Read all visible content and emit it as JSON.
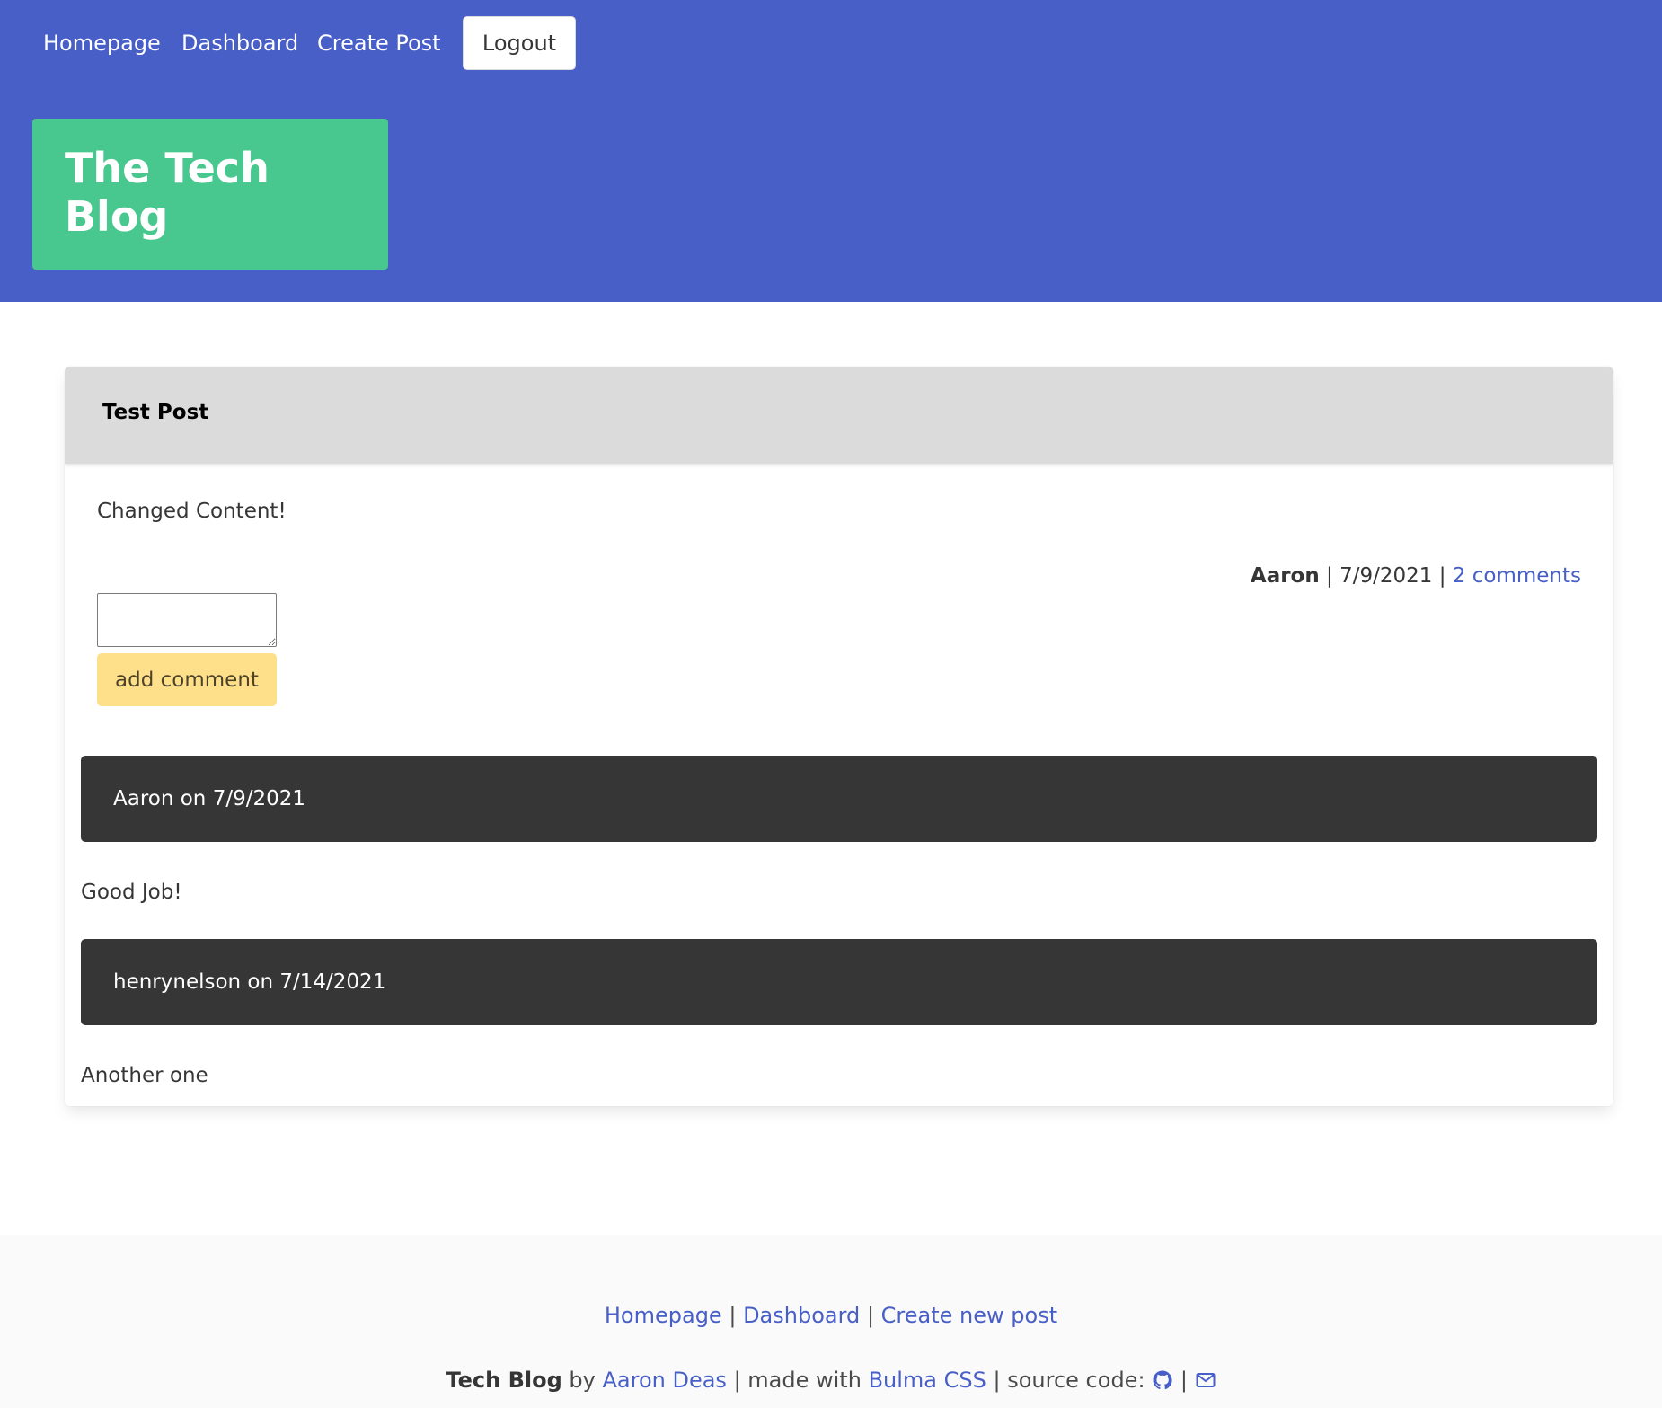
{
  "nav": {
    "homepage": "Homepage",
    "dashboard": "Dashboard",
    "create_post": "Create Post",
    "logout": "Logout"
  },
  "brand": {
    "title": "The Tech Blog"
  },
  "post": {
    "title": "Test Post",
    "content": "Changed Content!",
    "author": "Aaron",
    "date": "7/9/2021",
    "comments_link": "2 comments",
    "separator": "|"
  },
  "comment_form": {
    "value": "",
    "button_label": "add comment"
  },
  "comments": [
    {
      "header": "Aaron on 7/9/2021",
      "body": "Good Job!"
    },
    {
      "header": "henrynelson on 7/14/2021",
      "body": "Another one"
    }
  ],
  "footer": {
    "links": {
      "homepage": "Homepage",
      "dashboard": "Dashboard",
      "create_new_post": "Create new post",
      "separator": "|"
    },
    "credits": {
      "site_name": "Tech Blog",
      "by": "by",
      "author": "Aaron Deas",
      "made_with": "| made with",
      "framework": "Bulma CSS",
      "source_code": "| source code:",
      "separator": "|"
    }
  },
  "colors": {
    "hero": "#485fc7",
    "brand_box": "#48c78e",
    "button_warning": "#ffe08a",
    "comment_bar": "#363636",
    "link": "#485fc7"
  },
  "icons": [
    "github-icon",
    "envelope-icon"
  ]
}
